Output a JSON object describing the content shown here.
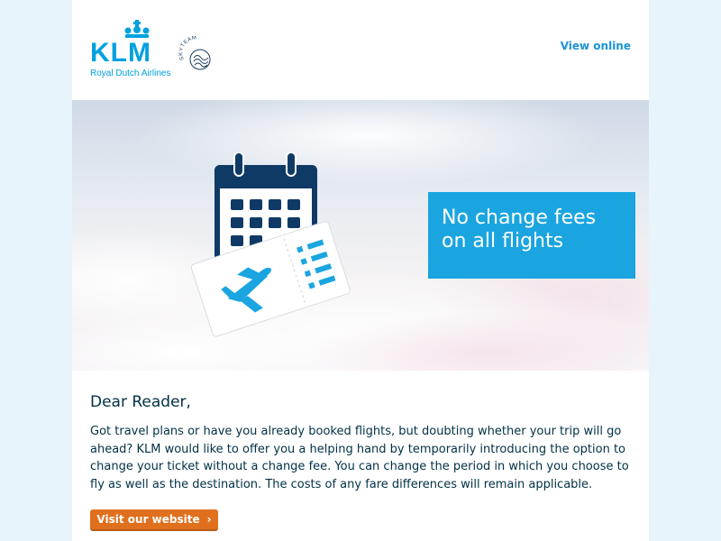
{
  "header": {
    "logo_text": "KLM",
    "logo_subtitle": "Royal Dutch Airlines",
    "alliance_text": "SKYTEAM",
    "view_online_label": "View online"
  },
  "hero": {
    "promo_line1": "No change fees",
    "promo_line2": "on all flights"
  },
  "body": {
    "greeting": "Dear Reader,",
    "paragraph": "Got travel plans or have you already booked flights, but doubting whether your trip will go ahead? KLM would like to offer you a helping hand by temporarily introducing the option to change your ticket without a change fee. You can change the period in which you choose to fly as well as the destination. The costs of any fare differences will remain applicable.",
    "cta_label": "Visit our website"
  },
  "colors": {
    "brand_blue": "#00a1de",
    "promo_blue": "#1aa5e0",
    "cta_orange": "#e0701e",
    "text_dark": "#003145",
    "icon_navy": "#0f3a66"
  }
}
